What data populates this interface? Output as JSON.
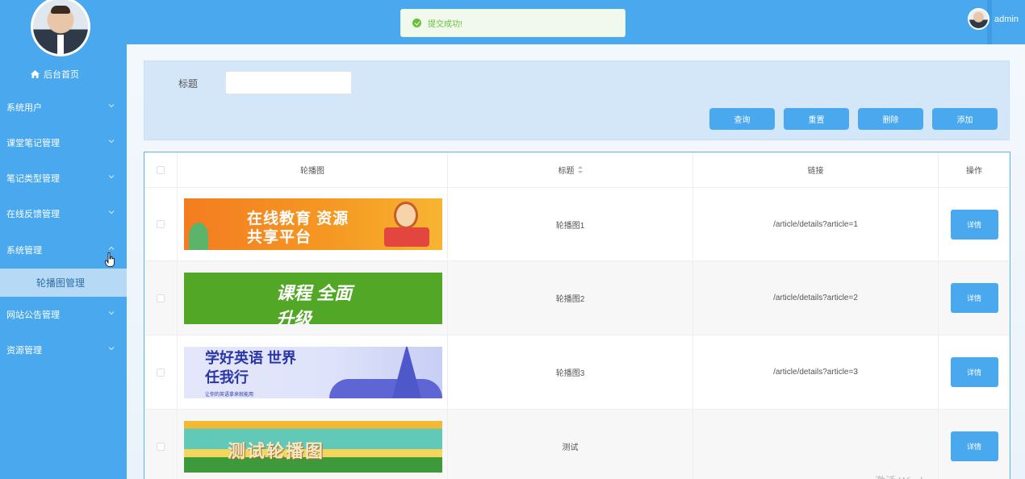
{
  "sidebar": {
    "home_label": "后台首页",
    "items": [
      {
        "label": "系统用户"
      },
      {
        "label": "课堂笔记管理"
      },
      {
        "label": "笔记类型管理"
      },
      {
        "label": "在线反馈管理"
      },
      {
        "label": "系统管理"
      },
      {
        "label": "网站公告管理"
      },
      {
        "label": "资源管理"
      }
    ],
    "active_submenu": "轮播图管理"
  },
  "header": {
    "username": "admin"
  },
  "toast": {
    "message": "提交成功!"
  },
  "search": {
    "title_label": "标题",
    "title_value": "",
    "buttons": {
      "query": "查询",
      "reset": "重置",
      "delete": "删除",
      "add": "添加"
    }
  },
  "table": {
    "headers": {
      "image": "轮播图",
      "title": "标题",
      "link": "链接",
      "actions": "操作"
    },
    "rows": [
      {
        "banner_text": "在线教育 资源共享平台",
        "title": "轮播图1",
        "link": "/article/details?article=1",
        "action": "详情"
      },
      {
        "banner_text": "课程 全面升级",
        "title": "轮播图2",
        "link": "/article/details?article=2",
        "action": "详情"
      },
      {
        "banner_text": "学好英语 世界任我行",
        "banner_subtext": "让你的英语拿来就能用",
        "title": "轮播图3",
        "link": "/article/details?article=3",
        "action": "详情"
      },
      {
        "banner_text": "测试轮播图",
        "title": "测试",
        "link": "",
        "action": "详情"
      }
    ]
  },
  "watermark": "激活 Windows",
  "colors": {
    "primary": "#49a8ee",
    "submenu_active_bg": "#b6daf6",
    "toast_success": "#67c23a"
  }
}
